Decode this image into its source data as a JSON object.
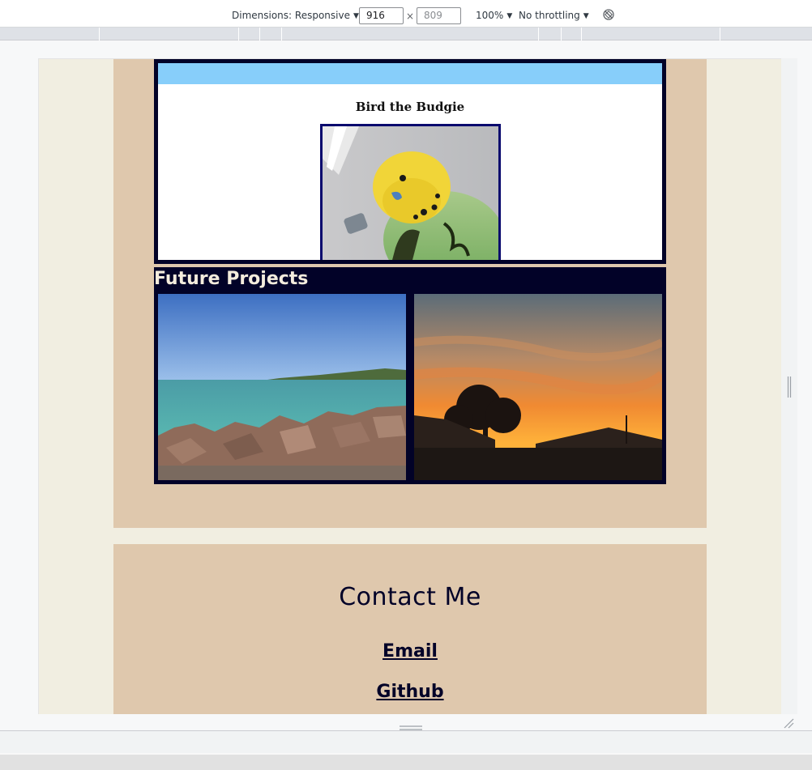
{
  "devtools": {
    "dimensions_label": "Dimensions: Responsive",
    "width_value": "916",
    "height_value": "809",
    "times_sign": "×",
    "zoom_label": "100%",
    "throttle_label": "No throttling",
    "caret": "▼"
  },
  "page": {
    "budgie_title": "Bird the Budgie",
    "future_title": "Future Projects",
    "contact_title": "Contact Me",
    "email_label": "Email",
    "github_label": "Github"
  },
  "colors": {
    "page_bg": "#f1eee1",
    "card_bg": "#dfc8ad",
    "navy": "#020228",
    "sky": "#87cefa",
    "title_cream": "#f4ecdd"
  },
  "icons": {
    "rotate": "rotate-icon",
    "resize_handle": "resize-handle-icon"
  }
}
